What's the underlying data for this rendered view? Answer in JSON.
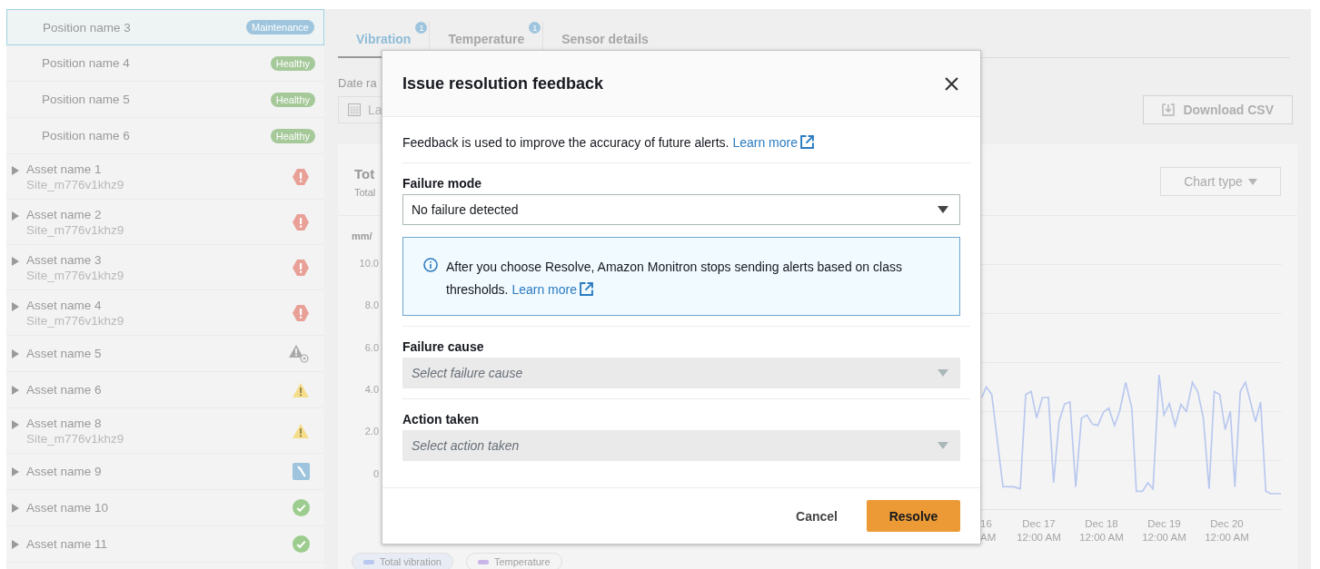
{
  "sidebar": {
    "items": [
      {
        "kind": "position",
        "name": "Position name 3",
        "status": "Maintenance",
        "color": "#9ec5dd",
        "selected": true
      },
      {
        "kind": "position",
        "name": "Position name 4",
        "status": "Healthy",
        "color": "#a6c99a",
        "selected": false
      },
      {
        "kind": "position",
        "name": "Position name 5",
        "status": "Healthy",
        "color": "#a6c99a",
        "selected": false
      },
      {
        "kind": "position",
        "name": "Position name 6",
        "status": "Healthy",
        "color": "#a6c99a",
        "selected": false
      },
      {
        "kind": "critical",
        "name": "Asset name 1",
        "site": "Site_m776v1khz9",
        "selected": false
      },
      {
        "kind": "critical",
        "name": "Asset name 2",
        "site": "Site_m776v1khz9",
        "selected": false
      },
      {
        "kind": "critical",
        "name": "Asset name 3",
        "site": "Site_m776v1khz9",
        "selected": false
      },
      {
        "kind": "critical",
        "name": "Asset name 4",
        "site": "Site_m776v1khz9",
        "selected": false
      },
      {
        "kind": "offline",
        "name": "Asset name 5",
        "selected": false
      },
      {
        "kind": "warning",
        "name": "Asset name 6",
        "selected": false
      },
      {
        "kind": "warning",
        "name": "Asset name 8",
        "site": "Site_m776v1khz9",
        "selected": false
      },
      {
        "kind": "maintenance",
        "name": "Asset name 9",
        "selected": false
      },
      {
        "kind": "healthy",
        "name": "Asset name 10",
        "selected": false
      },
      {
        "kind": "healthy",
        "name": "Asset name 11",
        "selected": false
      }
    ]
  },
  "tabs": [
    {
      "label": "Vibration",
      "badge": "1",
      "selected": true
    },
    {
      "label": "Temperature",
      "badge": "1",
      "selected": false
    },
    {
      "label": "Sensor details",
      "selected": false
    }
  ],
  "date_range": {
    "label": "Date ra",
    "value": "La"
  },
  "download_button": "Download CSV",
  "chart_card": {
    "title": "Tot",
    "subtitle": "Total",
    "chart_type_button": "Chart type",
    "y_unit": "mm/",
    "y_ticks": [
      "10.0",
      "8.0",
      "6.0",
      "4.0",
      "2.0",
      "0"
    ],
    "x_labels": [
      "16\nAM",
      "Dec 17\n12:00 AM",
      "Dec 18\n12:00 AM",
      "Dec 19\n12:00 AM",
      "Dec 20\n12:00 AM"
    ],
    "legend": [
      {
        "label": "Total vibration",
        "color": "#b9c8ef"
      },
      {
        "label": "Temperature",
        "color": "#c9b5e8"
      }
    ]
  },
  "modal": {
    "title": "Issue resolution feedback",
    "description": {
      "text": "Feedback is used to improve the accuracy of future alerts.",
      "link": "Learn more"
    },
    "failure_mode": {
      "label": "Failure mode",
      "value": "No failure detected",
      "disabled": false
    },
    "info": {
      "text": "After you choose Resolve, Amazon Monitron stops sending alerts based on class thresholds.",
      "link": "Learn more"
    },
    "failure_cause": {
      "label": "Failure cause",
      "placeholder": "Select failure cause",
      "disabled": true
    },
    "action_taken": {
      "label": "Action taken",
      "placeholder": "Select action taken",
      "disabled": true
    },
    "buttons": {
      "cancel": "Cancel",
      "primary": "Resolve"
    }
  }
}
